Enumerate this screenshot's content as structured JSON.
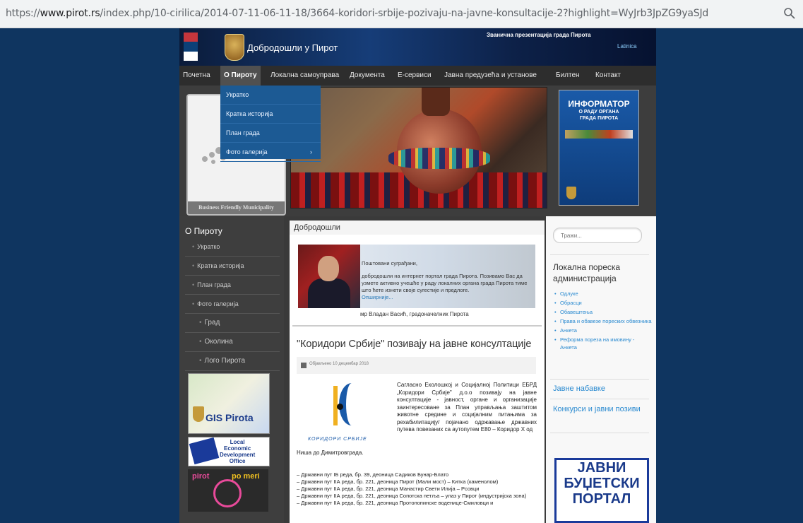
{
  "browser": {
    "url_prefix": "https://",
    "url_host": "www.pirot.rs",
    "url_path": "/index.php/10-cirilica/2014-07-11-06-11-18/3664-koridori-srbije-pozivaju-na-javne-konsultacije-2?highlight=WyJrb3JpZG9yaSJd"
  },
  "header": {
    "welcome": "Добродошли у Пирот",
    "official": "Званична презентација града Пирота",
    "latin_link": "Latinica"
  },
  "nav": {
    "items": [
      "Почетна",
      "О Пироту",
      "Локална самоуправа",
      "Документа",
      "Е-сервиси",
      "Јавна предузећа и установе",
      "Билтен",
      "Контакт"
    ]
  },
  "dropdown": {
    "items": [
      "Укратко",
      "Кратка историја",
      "План града",
      "Фото галерија"
    ],
    "chevron": "›"
  },
  "hero": {
    "bfm_caption": "Business Friendly Municipality",
    "informator_title": "ИНФОРМАТОР",
    "informator_sub1": "О РАДУ ОРГАНА",
    "informator_sub2": "ГРАДА ПИРОТА"
  },
  "left": {
    "heading": "О Пироту",
    "menu": [
      "Укратко",
      "Кратка историја",
      "План града",
      "Фото галерија"
    ],
    "submenu": [
      "Град",
      "Околина",
      "Лого Пирота"
    ],
    "gis_label": "GIS Pirota",
    "ledo_lines": [
      "Local",
      "Economic",
      "Development",
      "Office"
    ],
    "pirot_word": "pirot",
    "pirot_word2": "po meri"
  },
  "main": {
    "welcome_title": "Добродошли",
    "greeting": "Поштовани суграђани,",
    "mayor_text": "добродошли на интернет портал града Пирота. Позивамо Вас да узмете активно учешће у раду локалних органа града Пирота тиме што ћете изнети своје сугестије и предлоге.",
    "more": "Опширније...",
    "signature": "мр Владан Васић, градоначелник Пирота",
    "article_title": "\"Коридори Србије\" позивају на јавне консултације",
    "published": "Објављено 10 децембар 2018",
    "logo_name": "КОРИДОРИ СРБИЈЕ",
    "body": "Сагласно Еколошкој и Социјалној Политици ЕБРД „Коридори Србије\" д.о.о позивају на јавне консултације - јавност, органе и организације заинтересоване за План управљања заштитом животне средине и социјалним питањима за рехабилитацију/ појачано одржавање државних путева повезаних са аутопутем Е80 – Коридор Х од",
    "body_cont": "Ниша до Димитровграда.",
    "list": [
      "– Државни пут IБ реда, бр. 39, деоница Садиков Бунар-Блато",
      "– Државни пут IIА реда, бр. 221, деоница Пирот (Мали мост) – Китка (каменолом)",
      "– Државни пут IIА реда, бр. 221, деоница Манастир Свети Илија – Рсовци",
      "– Државни пут IIА реда, бр. 221, деоница Сопотска петља – улаз у Пирот (индустријска зона)",
      "– Државни пут IIА реда, бр. 221, деоница Протопопинске воденице-Смиловци и"
    ]
  },
  "right": {
    "search_placeholder": "Тражи...",
    "tax_heading": "Локална пореска администрација",
    "tax_links": [
      "Одлуке",
      "Обрасци",
      "Обавештења",
      "Права и обавезе пореских обвезника",
      "Анкета",
      "Реформа пореза на имовину - Анкета"
    ],
    "public_procurement": "Јавне набавке",
    "competitions": "Конкурси и јавни позиви",
    "budget_lines": [
      "ЈАВНИ",
      "БУЏЕТСКИ",
      "ПОРТАЛ"
    ]
  }
}
